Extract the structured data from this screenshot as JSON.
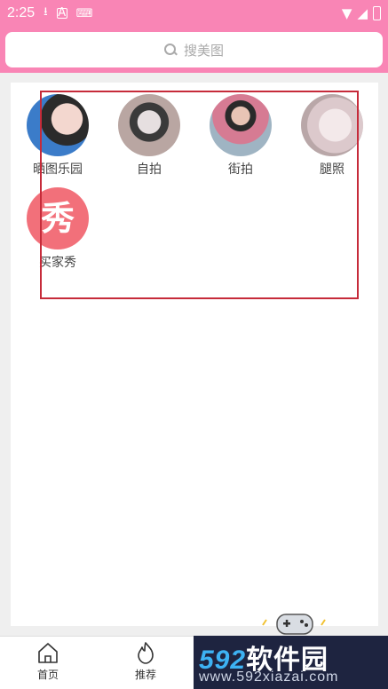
{
  "status_bar": {
    "time": "2:25",
    "icons": [
      "download-icon",
      "a-box-icon",
      "keyboard-icon"
    ],
    "right_icons": [
      "wifi-icon",
      "signal-icon",
      "battery-icon"
    ]
  },
  "search": {
    "placeholder": "搜美图"
  },
  "categories": [
    {
      "label": "晒图乐园",
      "icon": "avatar-photo"
    },
    {
      "label": "自拍",
      "icon": "avatar-photo"
    },
    {
      "label": "街拍",
      "icon": "avatar-photo"
    },
    {
      "label": "腿照",
      "icon": "avatar-photo"
    },
    {
      "label": "买家秀",
      "glyph": "秀"
    }
  ],
  "bottom_nav": [
    {
      "label": "首页",
      "icon": "home-icon"
    },
    {
      "label": "推荐",
      "icon": "fire-icon"
    }
  ],
  "watermark": {
    "num": "592",
    "cn": "软件园",
    "url": "www.592xiazai.com"
  },
  "colors": {
    "header": "#f985b5",
    "highlight": "#c62b3a",
    "xiu_badge": "#f2707a"
  }
}
